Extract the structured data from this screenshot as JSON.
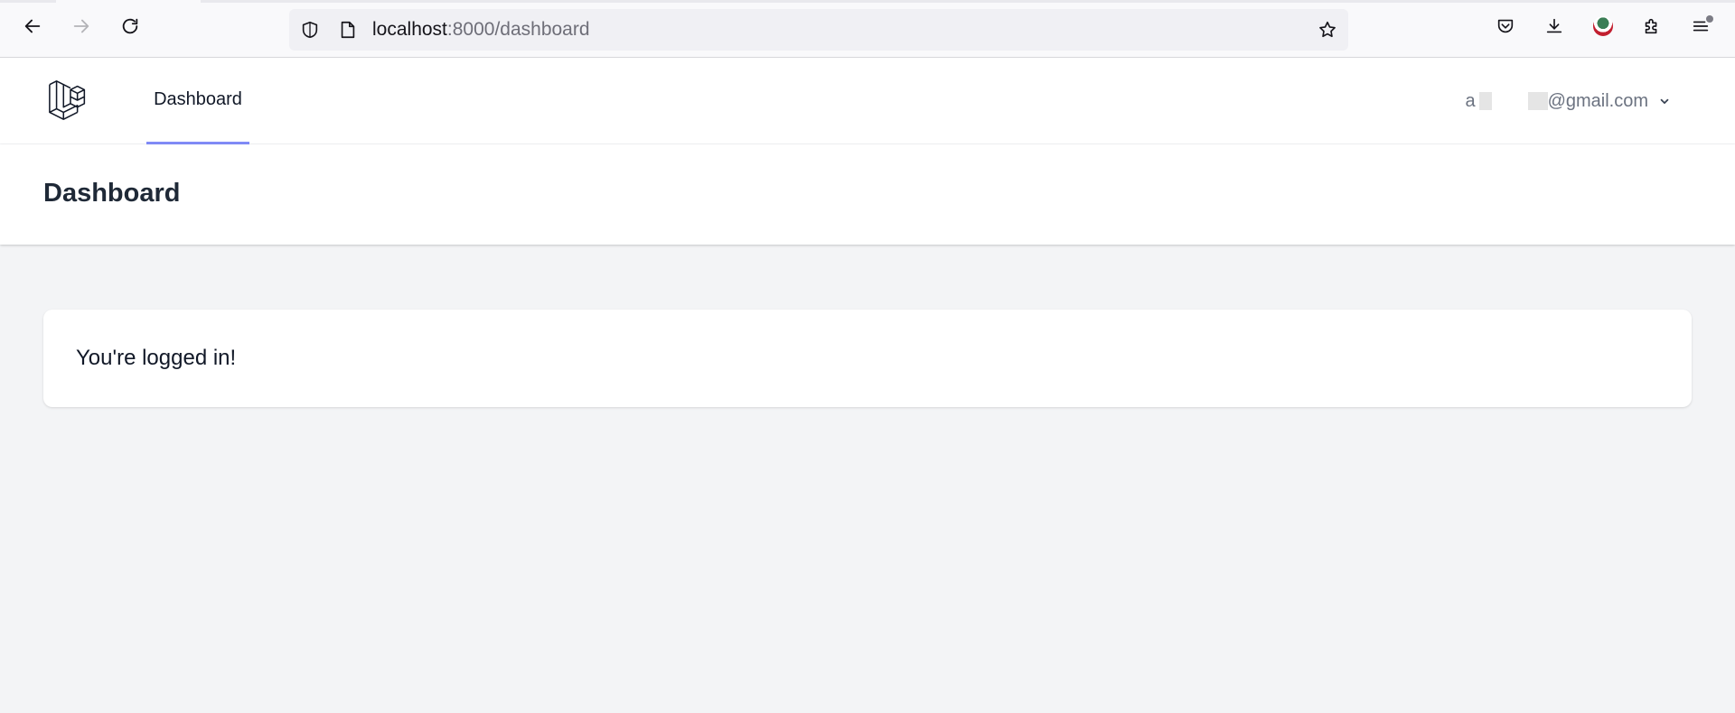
{
  "browser": {
    "url_host": "localhost",
    "url_rest": ":8000/dashboard"
  },
  "nav": {
    "brand_icon": "laravel-logo-icon",
    "links": [
      {
        "label": "Dashboard",
        "active": true
      }
    ],
    "accent_color": "#818cf8",
    "user_prefix": "a",
    "user_suffix": "@gmail.com"
  },
  "header": {
    "title": "Dashboard"
  },
  "card": {
    "message": "You're logged in!"
  },
  "colors": {
    "page_background": "#f3f4f6",
    "surface": "#ffffff"
  }
}
